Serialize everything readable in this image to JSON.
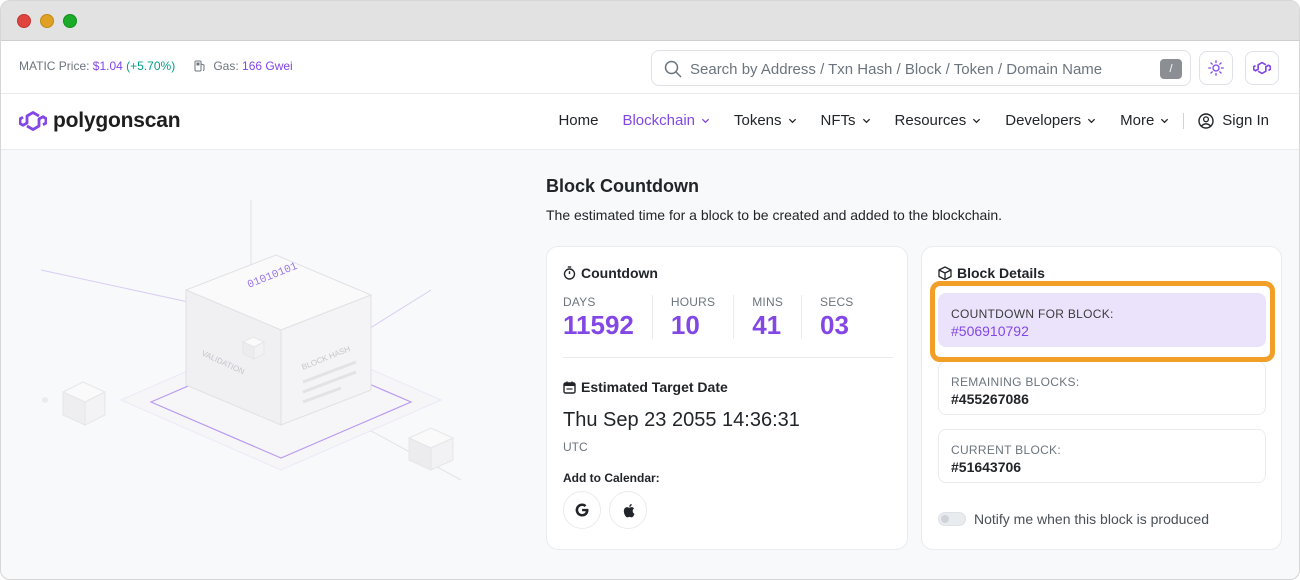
{
  "topbar": {
    "price_label": "MATIC Price:",
    "price_value": "$1.04",
    "price_change": "(+5.70%)",
    "gas_label": "Gas:",
    "gas_value": "166 Gwei",
    "search_placeholder": "Search by Address / Txn Hash / Block / Token / Domain Name",
    "search_shortcut": "/"
  },
  "navbar": {
    "brand": "polygonscan",
    "items": [
      {
        "label": "Home",
        "dropdown": false,
        "active": false
      },
      {
        "label": "Blockchain",
        "dropdown": true,
        "active": true
      },
      {
        "label": "Tokens",
        "dropdown": true,
        "active": false
      },
      {
        "label": "NFTs",
        "dropdown": true,
        "active": false
      },
      {
        "label": "Resources",
        "dropdown": true,
        "active": false
      },
      {
        "label": "Developers",
        "dropdown": true,
        "active": false
      },
      {
        "label": "More",
        "dropdown": true,
        "active": false
      }
    ],
    "sign_in": "Sign In"
  },
  "illustration": {
    "hash_text": "01010101",
    "face_left": "VALIDATION",
    "face_right": "BLOCK HASH"
  },
  "page": {
    "title": "Block Countdown",
    "subtitle": "The estimated time for a block to be created and added to the blockchain."
  },
  "countdown": {
    "heading": "Countdown",
    "units": [
      {
        "label": "DAYS",
        "value": "11592"
      },
      {
        "label": "HOURS",
        "value": "10"
      },
      {
        "label": "MINS",
        "value": "41"
      },
      {
        "label": "SECS",
        "value": "03"
      }
    ],
    "target_heading": "Estimated Target Date",
    "target_date": "Thu Sep 23 2055 14:36:31",
    "timezone": "UTC",
    "calendar_label": "Add to Calendar:"
  },
  "details": {
    "heading": "Block Details",
    "countdown_for_label": "COUNTDOWN FOR BLOCK:",
    "countdown_for_value": "#506910792",
    "remaining_label": "REMAINING BLOCKS:",
    "remaining_value": "#455267086",
    "current_label": "CURRENT BLOCK:",
    "current_value": "#51643706",
    "notify_label": "Notify me when this block is produced"
  },
  "colors": {
    "accent": "#8247e5",
    "positive": "#00a186",
    "highlight": "#f29f27"
  }
}
